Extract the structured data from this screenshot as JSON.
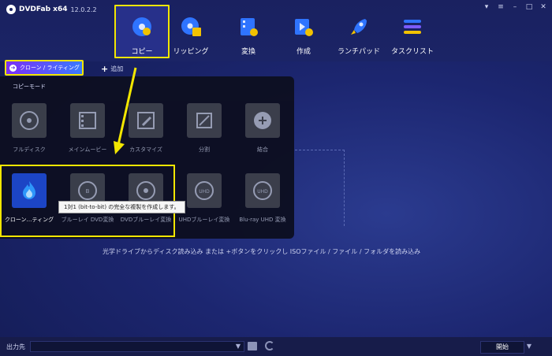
{
  "app": {
    "name": "DVDFab x64",
    "version": "12.0.2.2"
  },
  "nav": [
    {
      "label": "コピー",
      "icon": "disc-copy-icon",
      "active": true
    },
    {
      "label": "リッピング",
      "icon": "disc-rip-icon"
    },
    {
      "label": "変換",
      "icon": "convert-film-icon"
    },
    {
      "label": "作成",
      "icon": "create-video-icon"
    },
    {
      "label": "ランチパッド",
      "icon": "rocket-icon"
    },
    {
      "label": "タスクリスト",
      "icon": "task-list-icon"
    }
  ],
  "tabrow": {
    "clone_tab": "クローン / ライティング",
    "add": "追加"
  },
  "panel": {
    "title": "コピーモード",
    "modes_row1": [
      {
        "label": "フルディスク",
        "icon": "full-disc-icon"
      },
      {
        "label": "メインムービー",
        "icon": "main-movie-icon"
      },
      {
        "label": "カスタマイズ",
        "icon": "customize-icon"
      },
      {
        "label": "分割",
        "icon": "split-icon"
      },
      {
        "label": "結合",
        "icon": "merge-icon"
      }
    ],
    "modes_row2": [
      {
        "label": "クローン…ティング",
        "icon": "clone-flame-icon",
        "selected": true
      },
      {
        "label": "ブルーレイ DVD変換",
        "icon": "bluray-dvd-icon"
      },
      {
        "label": "DVDブルーレイ変換",
        "icon": "dvd-bluray-icon"
      },
      {
        "label": "UHDブルーレイ変換",
        "icon": "uhd-bluray-icon"
      },
      {
        "label": "Blu-ray UHD 変換",
        "icon": "bluray-uhd-icon"
      }
    ],
    "tooltip": "1対1 (bit-to-bit) の完全な複製を作成します。"
  },
  "main": {
    "hint": "光学ドライブからディスク読み込み または +ボタンをクリックし ISOファイル / ファイル / フォルダを読み込み"
  },
  "bottom": {
    "output_label": "出力先",
    "start": "開始"
  },
  "colors": {
    "highlight": "#f2e600",
    "accent": "#3a7bfd",
    "bg": "#1c2670"
  }
}
